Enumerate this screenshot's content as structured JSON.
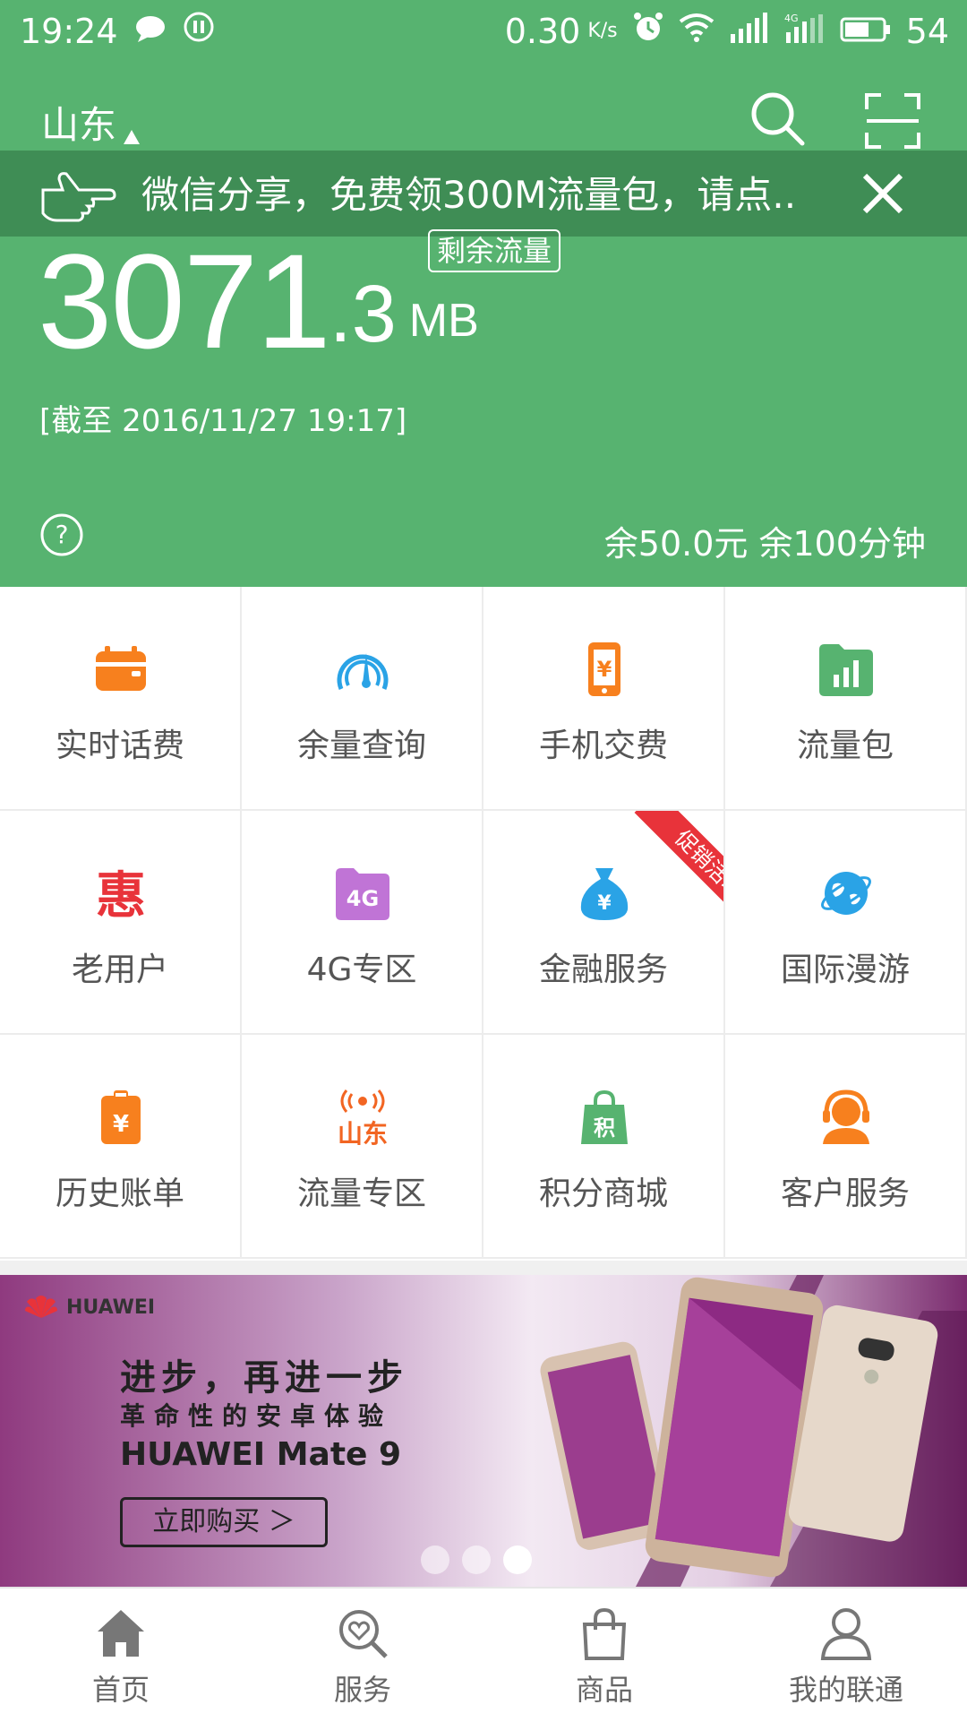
{
  "status_bar": {
    "time": "19:24",
    "net_speed": "0.30",
    "net_unit": "K/s",
    "battery": "54"
  },
  "header": {
    "region": "山东",
    "notice_text": "微信分享，免费领300M流量包，请点..",
    "data_badge": "剩余流量",
    "balance_int": "3071",
    "balance_dec": ".3",
    "balance_unit": "MB",
    "as_of": "[截至 2016/11/27 19:17]",
    "fees": "余50.0元 余100分钟"
  },
  "grid": {
    "items": [
      {
        "label": "实时话费",
        "icon": "wallet-icon"
      },
      {
        "label": "余量查询",
        "icon": "gauge-icon"
      },
      {
        "label": "手机交费",
        "icon": "phone-pay-icon"
      },
      {
        "label": "流量包",
        "icon": "data-package-icon"
      },
      {
        "label": "老用户",
        "icon": "discount-icon"
      },
      {
        "label": "4G专区",
        "icon": "4g-icon"
      },
      {
        "label": "金融服务",
        "icon": "money-bag-icon",
        "ribbon": "促销活动"
      },
      {
        "label": "国际漫游",
        "icon": "globe-icon"
      },
      {
        "label": "历史账单",
        "icon": "bill-icon"
      },
      {
        "label": "流量专区",
        "icon": "shandong-signal-icon"
      },
      {
        "label": "积分商城",
        "icon": "points-bag-icon"
      },
      {
        "label": "客户服务",
        "icon": "headset-icon"
      }
    ]
  },
  "banner": {
    "brand": "HUAWEI",
    "line1": "进步，再进一步",
    "line2": "革命性的安卓体验",
    "line3": "HUAWEI Mate 9",
    "button": "立即购买 ＞",
    "slides": 3,
    "active_slide": 3
  },
  "bottom_nav": {
    "items": [
      {
        "label": "首页",
        "icon": "home-icon",
        "active": true
      },
      {
        "label": "服务",
        "icon": "service-icon"
      },
      {
        "label": "商品",
        "icon": "shopping-bag-icon"
      },
      {
        "label": "我的联通",
        "icon": "user-icon"
      }
    ]
  },
  "colors": {
    "primary_green": "#57b370",
    "notice_green": "#3f8d55",
    "orange": "#f7801e",
    "blue": "#2aa3e6",
    "red": "#e8333a",
    "purple": "#c074d6"
  }
}
